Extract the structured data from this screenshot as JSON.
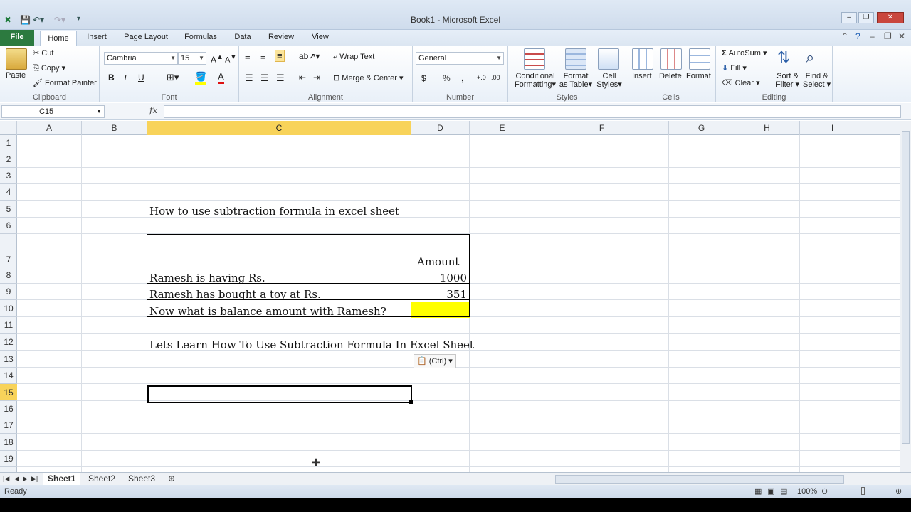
{
  "window": {
    "title": "Book1 - Microsoft Excel"
  },
  "tabs": [
    "File",
    "Home",
    "Insert",
    "Page Layout",
    "Formulas",
    "Data",
    "Review",
    "View"
  ],
  "clipboard": {
    "paste": "Paste",
    "cut": "Cut",
    "copy": "Copy",
    "format_painter": "Format Painter",
    "label": "Clipboard"
  },
  "font": {
    "name": "Cambria",
    "size": "15",
    "bold": "B",
    "italic": "I",
    "underline": "U",
    "label": "Font"
  },
  "alignment": {
    "wrap_text": "Wrap Text",
    "merge_center": "Merge & Center",
    "label": "Alignment"
  },
  "number": {
    "format": "General",
    "currency": "$",
    "percent": "%",
    "comma": ",",
    "label": "Number"
  },
  "styles": {
    "conditional1": "Conditional",
    "conditional2": "Formatting",
    "format_table1": "Format",
    "format_table2": "as Table",
    "cell_styles1": "Cell",
    "cell_styles2": "Styles",
    "label": "Styles"
  },
  "cells_group": {
    "insert": "Insert",
    "delete": "Delete",
    "format": "Format",
    "label": "Cells"
  },
  "editing": {
    "autosum": "AutoSum",
    "fill": "Fill",
    "clear": "Clear",
    "sort1": "Sort &",
    "sort2": "Filter",
    "find1": "Find &",
    "find2": "Select",
    "label": "Editing"
  },
  "formula_bar": {
    "name_box": "C15",
    "fx": "fx",
    "value": ""
  },
  "columns": [
    "A",
    "B",
    "C",
    "D",
    "E",
    "F",
    "G",
    "H",
    "I"
  ],
  "rows": [
    "1",
    "2",
    "3",
    "4",
    "5",
    "6",
    "7",
    "8",
    "9",
    "10",
    "11",
    "12",
    "13",
    "14",
    "15",
    "16",
    "17",
    "18",
    "19"
  ],
  "sheet": {
    "c5": "How to use subtraction formula in excel sheet",
    "d7": "Amount",
    "c8": "Ramesh is having Rs.",
    "d8": "1000",
    "c9": "Ramesh has bought a toy at Rs.",
    "d9": "351",
    "c10": "Now what is balance amount with Ramesh?",
    "c12": "Lets Learn How To Use Subtraction Formula In Excel Sheet",
    "paste_options": "(Ctrl)"
  },
  "sheet_tabs": [
    "Sheet1",
    "Sheet2",
    "Sheet3"
  ],
  "status": {
    "ready": "Ready",
    "zoom": "100%"
  },
  "colors": {
    "file_tab": "#2c7a3f",
    "selected_header": "#f8d35a",
    "highlight_cell": "#ffff00"
  }
}
